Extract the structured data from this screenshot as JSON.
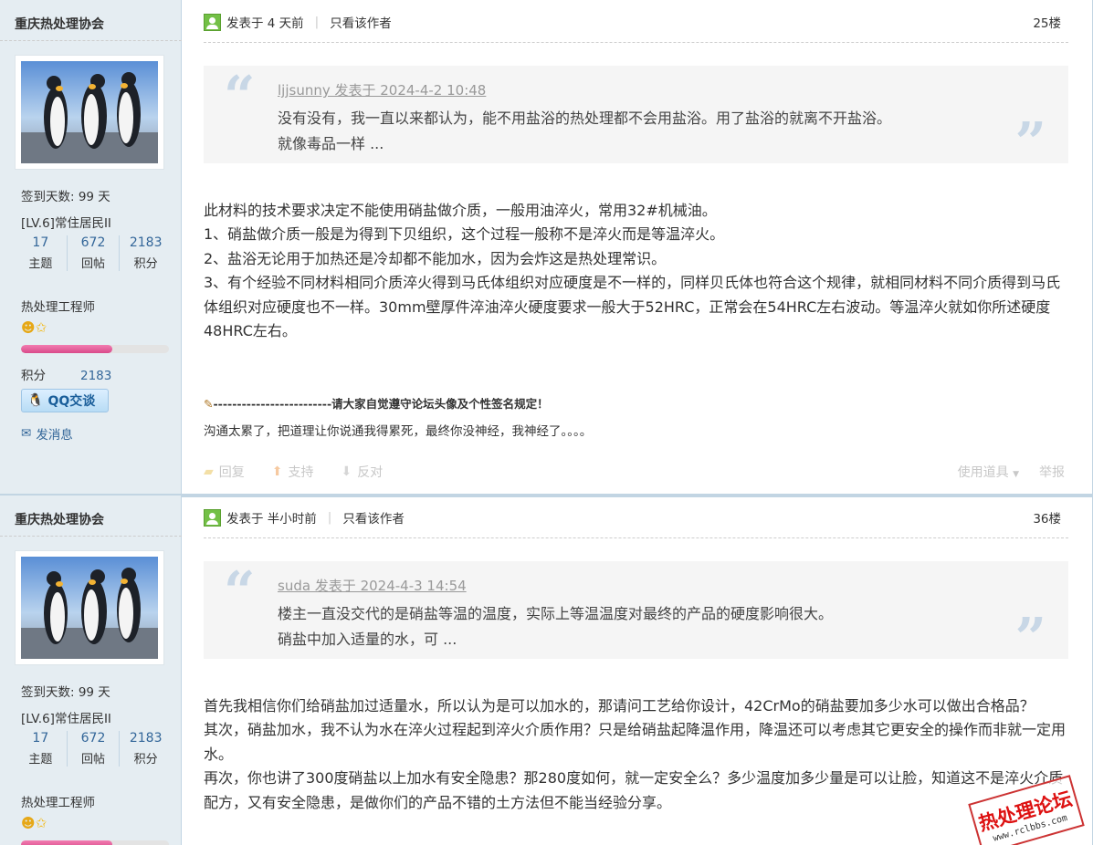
{
  "posts": [
    {
      "username": "重庆热处理协会",
      "sign_days": "签到天数: 99 天",
      "level": "[LV.6]常住居民II",
      "stats": [
        {
          "num": "17",
          "label": "主题"
        },
        {
          "num": "672",
          "label": "回帖"
        },
        {
          "num": "2183",
          "label": "积分"
        }
      ],
      "title_rank": "热处理工程师",
      "credits_label": "积分",
      "credits_value": "2183",
      "qq_label": "QQ交谈",
      "msg_label": "发消息",
      "posted": "发表于 4 天前",
      "only_author": "只看该作者",
      "floor": "25楼",
      "quote_by": "ljjsunny 发表于 2024-4-2 10:48",
      "quote_lines": [
        "没有没有，我一直以来都认为，能不用盐浴的热处理都不会用盐浴。用了盐浴的就离不开盐浴。",
        "就像毒品一样 ..."
      ],
      "content": [
        "此材料的技术要求决定不能使用硝盐做介质，一般用油淬火，常用32#机械油。",
        "1、硝盐做介质一般是为得到下贝组织，这个过程一般称不是淬火而是等温淬火。",
        "2、盐浴无论用于加热还是冷却都不能加水，因为会炸这是热处理常识。",
        "3、有个经验不同材料相同介质淬火得到马氏体组织对应硬度是不一样的，同样贝氏体也符合这个规律，就相同材料不同介质得到马氏体组织对应硬度也不一样。30mm壁厚件淬油淬火硬度要求一般大于52HRC，正常会在54HRC左右波动。等温淬火就如你所述硬度48HRC左右。"
      ],
      "sig_line": "-------------------------请大家自觉遵守论坛头像及个性签名规定！",
      "sig_text": "沟通太累了，把道理让你说通我得累死，最终你没神经，我神经了。。。。",
      "actions": {
        "reply": "回复",
        "support": "支持",
        "oppose": "反对",
        "tools": "使用道具",
        "report": "举报"
      }
    },
    {
      "username": "重庆热处理协会",
      "sign_days": "签到天数: 99 天",
      "level": "[LV.6]常住居民II",
      "stats": [
        {
          "num": "17",
          "label": "主题"
        },
        {
          "num": "672",
          "label": "回帖"
        },
        {
          "num": "2183",
          "label": "积分"
        }
      ],
      "title_rank": "热处理工程师",
      "posted": "发表于 半小时前",
      "only_author": "只看该作者",
      "floor": "36楼",
      "quote_by": "suda 发表于 2024-4-3 14:54",
      "quote_lines": [
        "楼主一直没交代的是硝盐等温的温度，实际上等温温度对最终的产品的硬度影响很大。",
        "硝盐中加入适量的水，可 ..."
      ],
      "content": [
        "首先我相信你们给硝盐加过适量水，所以认为是可以加水的，那请问工艺给你设计，42CrMo的硝盐要加多少水可以做出合格品？",
        "其次，硝盐加水，我不认为水在淬火过程起到淬火介质作用？只是给硝盐起降温作用，降温还可以考虑其它更安全的操作而非就一定用水。",
        "再次，你也讲了300度硝盐以上加水有安全隐患？那280度如何，就一定安全么？多少温度加多少量是可以让脸，知道这不是淬火介质配方，又有安全隐患，是做你们的产品不错的土方法但不能当经验分享。"
      ]
    }
  ],
  "watermark": {
    "title": "热处理论坛",
    "url": "www.rclbbs.com"
  },
  "colors": {
    "sidebar_bg": "#e5edf2",
    "border": "#c2d5e3",
    "link": "#336699",
    "quote_bg": "#f5f5f5",
    "rank_bar": "#e0589a"
  },
  "rank_progress": 0.62
}
